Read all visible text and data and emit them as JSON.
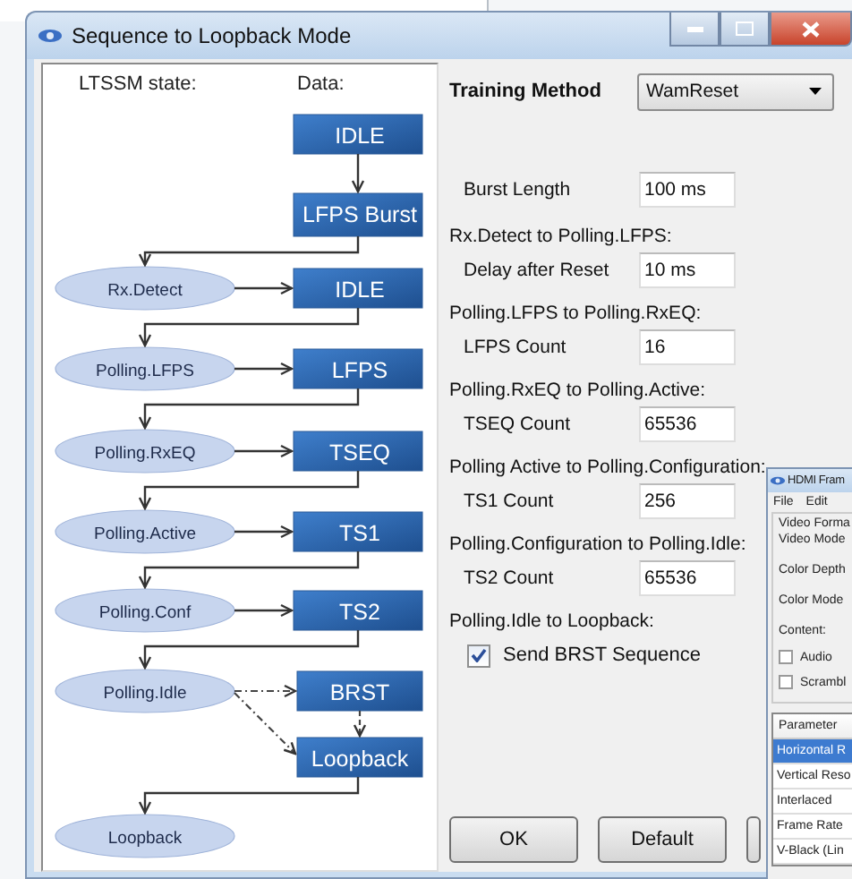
{
  "window": {
    "title": "Sequence to Loopback Mode"
  },
  "diagram": {
    "state_heading": "LTSSM state:",
    "data_heading": "Data:",
    "data_boxes": [
      {
        "label": "IDLE"
      },
      {
        "label": "LFPS Burst"
      },
      {
        "label": "IDLE"
      },
      {
        "label": "LFPS"
      },
      {
        "label": "TSEQ"
      },
      {
        "label": "TS1"
      },
      {
        "label": "TS2"
      },
      {
        "label": "BRST"
      },
      {
        "label": "Loopback"
      }
    ],
    "states": [
      {
        "label": "Rx.Detect"
      },
      {
        "label": "Polling.LFPS"
      },
      {
        "label": "Polling.RxEQ"
      },
      {
        "label": "Polling.Active"
      },
      {
        "label": "Polling.Conf"
      },
      {
        "label": "Polling.Idle"
      },
      {
        "label": "Loopback"
      }
    ]
  },
  "form": {
    "training_method": {
      "label": "Training Method",
      "value": "WamReset"
    },
    "burst": {
      "label": "Burst Length",
      "value": "100 ms"
    },
    "transitions": [
      {
        "kind": "field",
        "heading": "Rx.Detect to Polling.LFPS:",
        "label": "Delay after Reset",
        "value": "10 ms"
      },
      {
        "kind": "field",
        "heading": "Polling.LFPS to Polling.RxEQ:",
        "label": "LFPS Count",
        "value": "16"
      },
      {
        "kind": "field",
        "heading": "Polling.RxEQ to Polling.Active:",
        "label": "TSEQ Count",
        "value": "65536"
      },
      {
        "kind": "field",
        "heading": "Polling Active to Polling.Configuration:",
        "label": "TS1 Count",
        "value": "256"
      },
      {
        "kind": "field",
        "heading": "Polling.Configuration to Polling.Idle:",
        "label": "TS2 Count",
        "value": "65536"
      },
      {
        "kind": "checkbox",
        "heading": "Polling.Idle to Loopback:",
        "label": "Send BRST Sequence",
        "checked": true
      }
    ]
  },
  "buttons": [
    {
      "label": "OK"
    },
    {
      "label": "Default"
    }
  ],
  "hdmi_window": {
    "title": "HDMI Fram",
    "menu": [
      "File",
      "Edit"
    ],
    "labels": [
      "Video Forma",
      "Video Mode",
      "Color Depth",
      "Color Mode",
      "Content:"
    ],
    "checkboxes": [
      {
        "label": "Audio",
        "checked": false
      },
      {
        "label": "Scrambl",
        "checked": false
      }
    ],
    "table": {
      "columns": [
        "Parameter"
      ],
      "rows": [
        {
          "cells": [
            "Horizontal R"
          ],
          "selected": true
        },
        {
          "cells": [
            "Vertical Reso"
          ],
          "selected": false
        },
        {
          "cells": [
            "Interlaced"
          ],
          "selected": false
        },
        {
          "cells": [
            "Frame Rate"
          ],
          "selected": false
        },
        {
          "cells": [
            "V-Black (Lin"
          ],
          "selected": false
        }
      ]
    }
  }
}
